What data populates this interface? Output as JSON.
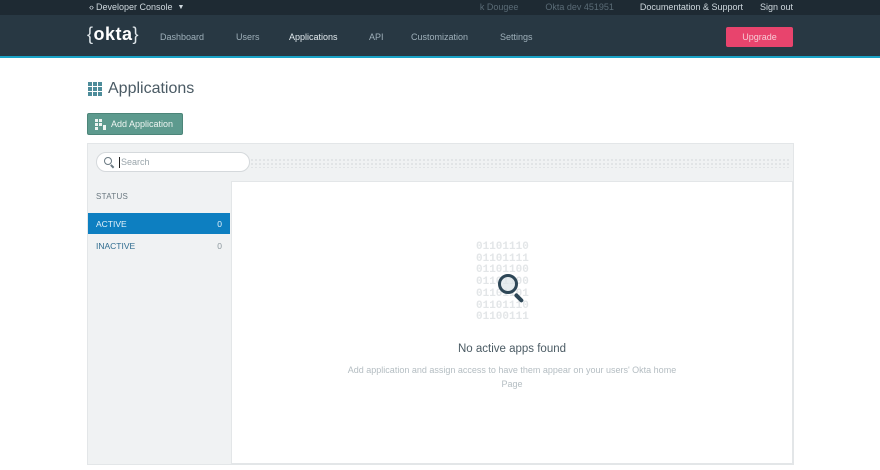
{
  "topbar": {
    "console_label": "Developer Console",
    "user_label": "k Dougee",
    "org_label": "Okta dev 451951",
    "docs_label": "Documentation & Support",
    "signout_label": "Sign out"
  },
  "nav": {
    "logo": "okta",
    "items": [
      "Dashboard",
      "Users",
      "Applications",
      "API",
      "Customization",
      "Settings"
    ],
    "active": "Applications",
    "upgrade_label": "Upgrade"
  },
  "page": {
    "title": "Applications",
    "add_button_label": "Add Application"
  },
  "search": {
    "placeholder": "Search"
  },
  "sidebar": {
    "status_heading": "STATUS",
    "filters": [
      {
        "label": "ACTIVE",
        "count": "0"
      },
      {
        "label": "INACTIVE",
        "count": "0"
      }
    ]
  },
  "empty_state": {
    "binary_lines": [
      "01101110",
      "01101111",
      "01101100",
      "01101100",
      "01101101",
      "01101110",
      "01100111"
    ],
    "title": "No active apps found",
    "description": "Add application and assign access to have them appear on your users' Okta home Page"
  },
  "colors": {
    "nav_bg": "#283843",
    "accent_underline": "#1aa3c7",
    "upgrade": "#e8446d",
    "add_button": "#5d9a8e",
    "active_filter": "#0d7fc1"
  }
}
